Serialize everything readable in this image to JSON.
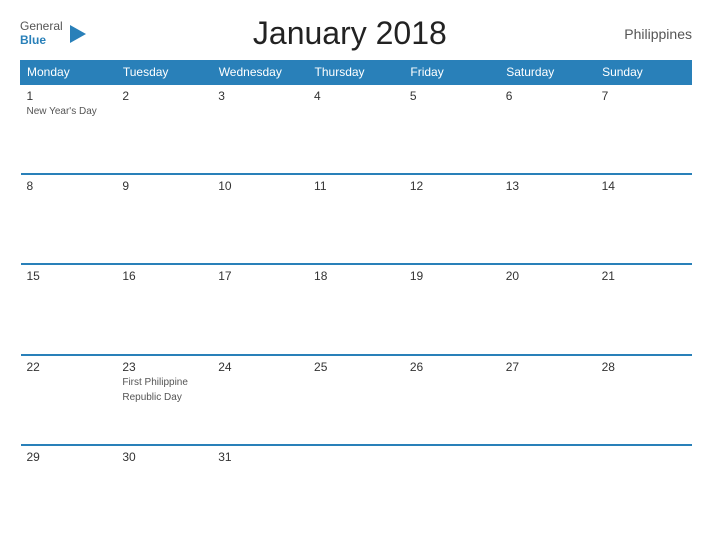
{
  "header": {
    "logo": {
      "general": "General",
      "blue": "Blue",
      "flag_shape": "triangle"
    },
    "title": "January 2018",
    "country": "Philippines"
  },
  "weekdays": [
    "Monday",
    "Tuesday",
    "Wednesday",
    "Thursday",
    "Friday",
    "Saturday",
    "Sunday"
  ],
  "weeks": [
    [
      {
        "day": "1",
        "events": [
          "New Year's Day"
        ]
      },
      {
        "day": "2",
        "events": []
      },
      {
        "day": "3",
        "events": []
      },
      {
        "day": "4",
        "events": []
      },
      {
        "day": "5",
        "events": []
      },
      {
        "day": "6",
        "events": []
      },
      {
        "day": "7",
        "events": []
      }
    ],
    [
      {
        "day": "8",
        "events": []
      },
      {
        "day": "9",
        "events": []
      },
      {
        "day": "10",
        "events": []
      },
      {
        "day": "11",
        "events": []
      },
      {
        "day": "12",
        "events": []
      },
      {
        "day": "13",
        "events": []
      },
      {
        "day": "14",
        "events": []
      }
    ],
    [
      {
        "day": "15",
        "events": []
      },
      {
        "day": "16",
        "events": []
      },
      {
        "day": "17",
        "events": []
      },
      {
        "day": "18",
        "events": []
      },
      {
        "day": "19",
        "events": []
      },
      {
        "day": "20",
        "events": []
      },
      {
        "day": "21",
        "events": []
      }
    ],
    [
      {
        "day": "22",
        "events": []
      },
      {
        "day": "23",
        "events": [
          "First Philippine",
          "Republic Day"
        ]
      },
      {
        "day": "24",
        "events": []
      },
      {
        "day": "25",
        "events": []
      },
      {
        "day": "26",
        "events": []
      },
      {
        "day": "27",
        "events": []
      },
      {
        "day": "28",
        "events": []
      }
    ],
    [
      {
        "day": "29",
        "events": []
      },
      {
        "day": "30",
        "events": []
      },
      {
        "day": "31",
        "events": []
      },
      {
        "day": "",
        "events": []
      },
      {
        "day": "",
        "events": []
      },
      {
        "day": "",
        "events": []
      },
      {
        "day": "",
        "events": []
      }
    ]
  ]
}
